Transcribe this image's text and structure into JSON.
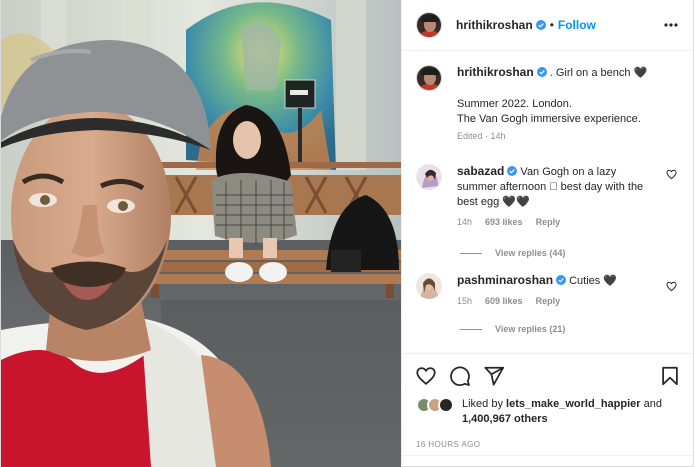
{
  "header": {
    "username": "hrithikroshan",
    "separator": "•",
    "follow_label": "Follow"
  },
  "caption": {
    "username": "hrithikroshan",
    "text": ". Girl on a bench 🖤",
    "line1": "Summer 2022. London.",
    "line2": "The Van Gogh immersive experience.",
    "meta": "Edited · 14h"
  },
  "comments": [
    {
      "username": "sabazad",
      "text": "Van Gogh on a lazy summer afternoon ⃞ best day with the best egg 🖤🖤",
      "time": "14h",
      "likes": "693 likes",
      "reply_label": "Reply",
      "view_replies": "View replies (44)"
    },
    {
      "username": "pashminaroshan",
      "text": "Cuties 🖤",
      "time": "15h",
      "likes": "609 likes",
      "reply_label": "Reply",
      "view_replies": "View replies (21)"
    }
  ],
  "likes": {
    "prefix": "Liked by",
    "user": "lets_make_world_happier",
    "and": "and",
    "others": "1,400,967 others"
  },
  "timestamp": "16 HOURS AGO",
  "icons": {
    "like": "heart-icon",
    "comment": "comment-icon",
    "share": "paper-plane-icon",
    "save": "bookmark-icon",
    "more": "more-horizontal-icon",
    "verified": "verified-badge-icon"
  },
  "colors": {
    "accent": "#0095f6",
    "verified": "#3897f0",
    "text": "#262626",
    "muted": "#8e8e8e"
  }
}
